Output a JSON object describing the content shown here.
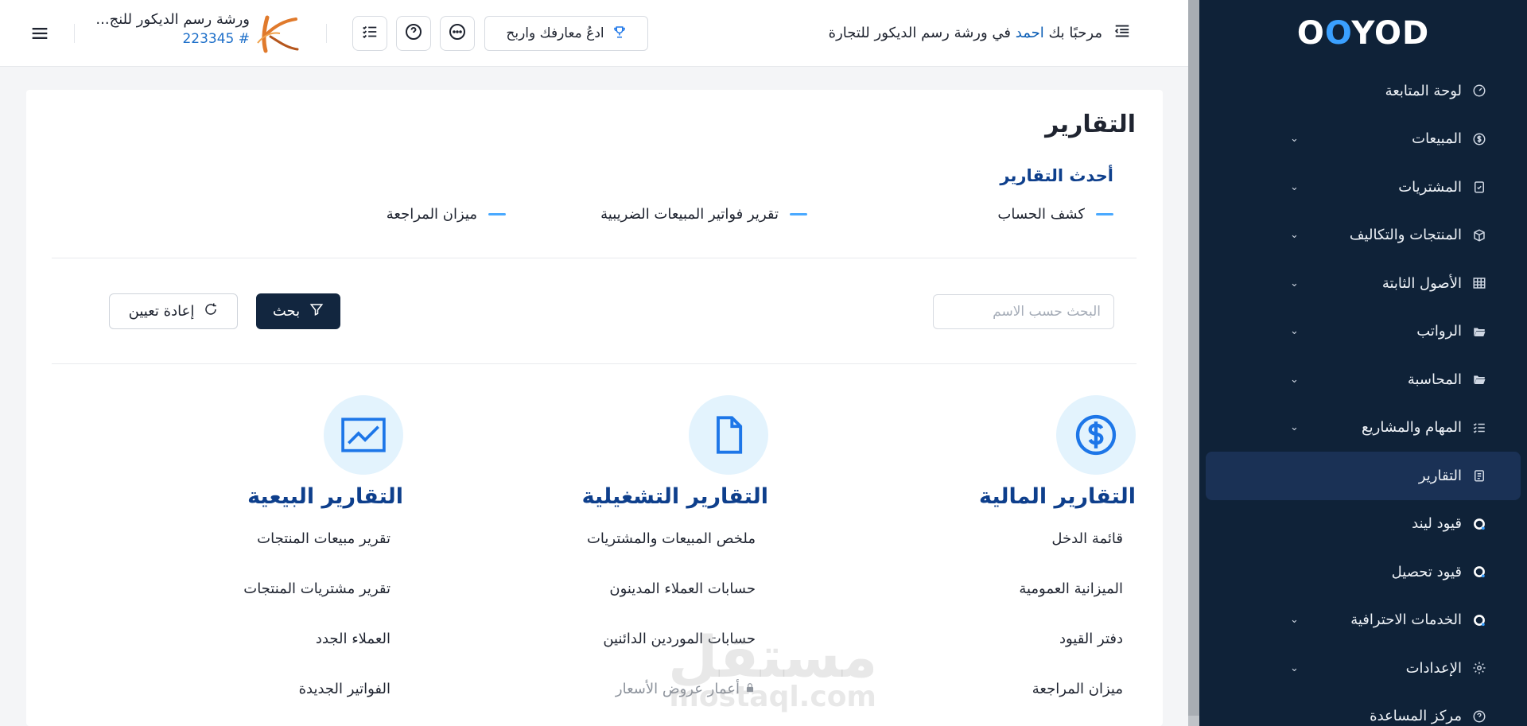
{
  "sidebar": {
    "logo": "OOYOD",
    "items": [
      {
        "label": "لوحة المتابعة",
        "icon": "gauge-icon",
        "has_chevron": false
      },
      {
        "label": "المبيعات",
        "icon": "dollar-circle-icon",
        "has_chevron": true
      },
      {
        "label": "المشتريات",
        "icon": "clipboard-check-icon",
        "has_chevron": true
      },
      {
        "label": "المنتجات والتكاليف",
        "icon": "box-icon",
        "has_chevron": true
      },
      {
        "label": "الأصول الثابتة",
        "icon": "grid-table-icon",
        "has_chevron": true
      },
      {
        "label": "الرواتب",
        "icon": "folder-open-icon",
        "has_chevron": true
      },
      {
        "label": "المحاسبة",
        "icon": "folder-open-icon",
        "has_chevron": true
      },
      {
        "label": "المهام والمشاريع",
        "icon": "task-list-icon",
        "has_chevron": true
      },
      {
        "label": "التقارير",
        "icon": "report-icon",
        "has_chevron": false,
        "active": true
      },
      {
        "label": "قيود ليند",
        "icon": "ooyod-o-icon",
        "has_chevron": false
      },
      {
        "label": "قيود تحصيل",
        "icon": "ooyod-o-icon",
        "has_chevron": false
      },
      {
        "label": "الخدمات الاحترافية",
        "icon": "ooyod-o-icon",
        "has_chevron": true
      },
      {
        "label": "الإعدادات",
        "icon": "gear-icon",
        "has_chevron": true
      },
      {
        "label": "مركز المساعدة",
        "icon": "help-circle-icon",
        "has_chevron": false
      }
    ]
  },
  "topbar": {
    "greeting_prefix": "مرحبًا بك",
    "user_name": "احمد",
    "greeting_suffix": "في ورشة رسم الديكور للتجارة",
    "invite_label": "ادعُ معارفك واربح",
    "company_name": "ورشة رسم الديكور للنج...",
    "company_id": "223345 #"
  },
  "main": {
    "title": "التقارير",
    "recent_title": "أحدث التقارير",
    "recent": [
      "كشف الحساب",
      "تقرير فواتير المبيعات الضريبية",
      "ميزان المراجعة"
    ],
    "search_placeholder": "البحث حسب الاسم",
    "search_button": "بحث",
    "reset_button": "إعادة تعيين",
    "columns": [
      {
        "title": "التقارير المالية",
        "icon": "dollar-circle-icon",
        "links": [
          "قائمة الدخل",
          "الميزانية العمومية",
          "دفتر القيود",
          "ميزان المراجعة"
        ]
      },
      {
        "title": "التقارير التشغيلية",
        "icon": "document-icon",
        "links": [
          "ملخص المبيعات والمشتريات",
          "حسابات العملاء المدينون",
          "حسابات الموردين الدائنين",
          "أعمار عروض الأسعار"
        ]
      },
      {
        "title": "التقارير البيعية",
        "icon": "trend-chart-icon",
        "links": [
          "تقرير مبيعات المنتجات",
          "تقرير مشتريات المنتجات",
          "العملاء الجدد",
          "الفواتير الجديدة"
        ]
      }
    ]
  },
  "watermark": {
    "line1": "مستقل",
    "line2": "mostaql.com"
  },
  "colors": {
    "sidebar_bg": "#0f2238",
    "active_bg": "#1a3155",
    "accent_blue": "#1d76e8",
    "title_blue": "#0e3f8c",
    "icon_circle": "#e3f3fd",
    "dark_button": "#12263f"
  }
}
